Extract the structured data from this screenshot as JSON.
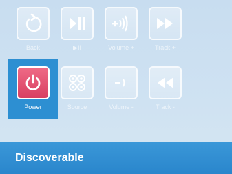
{
  "controls": {
    "row1": [
      {
        "label": "Back"
      },
      {
        "label": "▶II"
      },
      {
        "label": "Volume +"
      },
      {
        "label": "Track +"
      }
    ],
    "row2": [
      {
        "label": "Power"
      },
      {
        "label": "Source"
      },
      {
        "label": "Volume -"
      },
      {
        "label": "Track -"
      }
    ]
  },
  "status": {
    "title": "Discoverable"
  },
  "colors": {
    "active": "#2d8fd2",
    "power_button": "#e0506f",
    "bar": "#2f8ed1"
  }
}
